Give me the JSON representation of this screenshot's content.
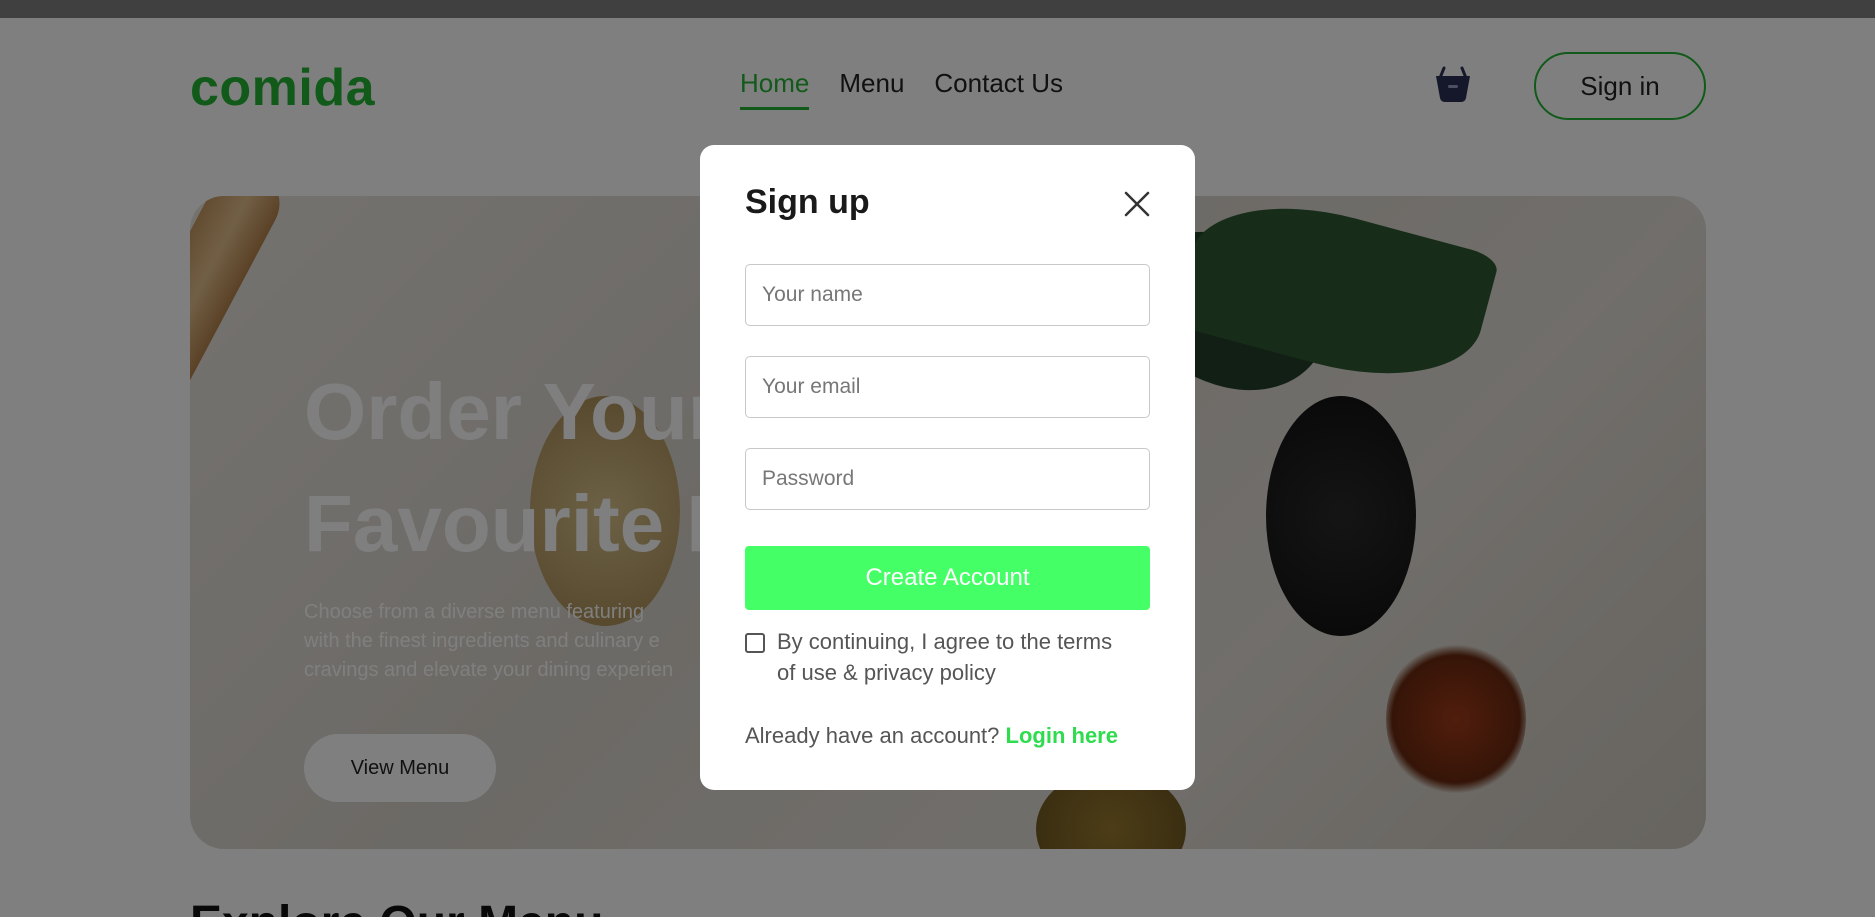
{
  "brand": {
    "name": "comida",
    "accent": "#22b534"
  },
  "nav": {
    "items": [
      {
        "label": "Home",
        "active": true
      },
      {
        "label": "Menu",
        "active": false
      },
      {
        "label": "Contact Us",
        "active": false
      }
    ],
    "cart_icon": "basket-icon",
    "signin_label": "Sign in"
  },
  "hero": {
    "title_line1": "Order Your",
    "title_line2": "Favourite F",
    "desc_line1": "Choose from a diverse menu featuring",
    "desc_line2": "with the finest ingredients and culinary e",
    "desc_line3": "cravings and elevate your dining experien",
    "button_label": "View Menu"
  },
  "section": {
    "title": "Explore Our Menu"
  },
  "modal": {
    "title": "Sign up",
    "close_icon": "close-icon",
    "name_placeholder": "Your name",
    "email_placeholder": "Your email",
    "password_placeholder": "Password",
    "create_label": "Create Account",
    "create_color": "#44ff66",
    "terms_line1": "By continuing, I agree to the terms",
    "terms_line2": "of use & privacy policy",
    "login_prompt": "Already have an account?",
    "login_link": "Login here"
  }
}
